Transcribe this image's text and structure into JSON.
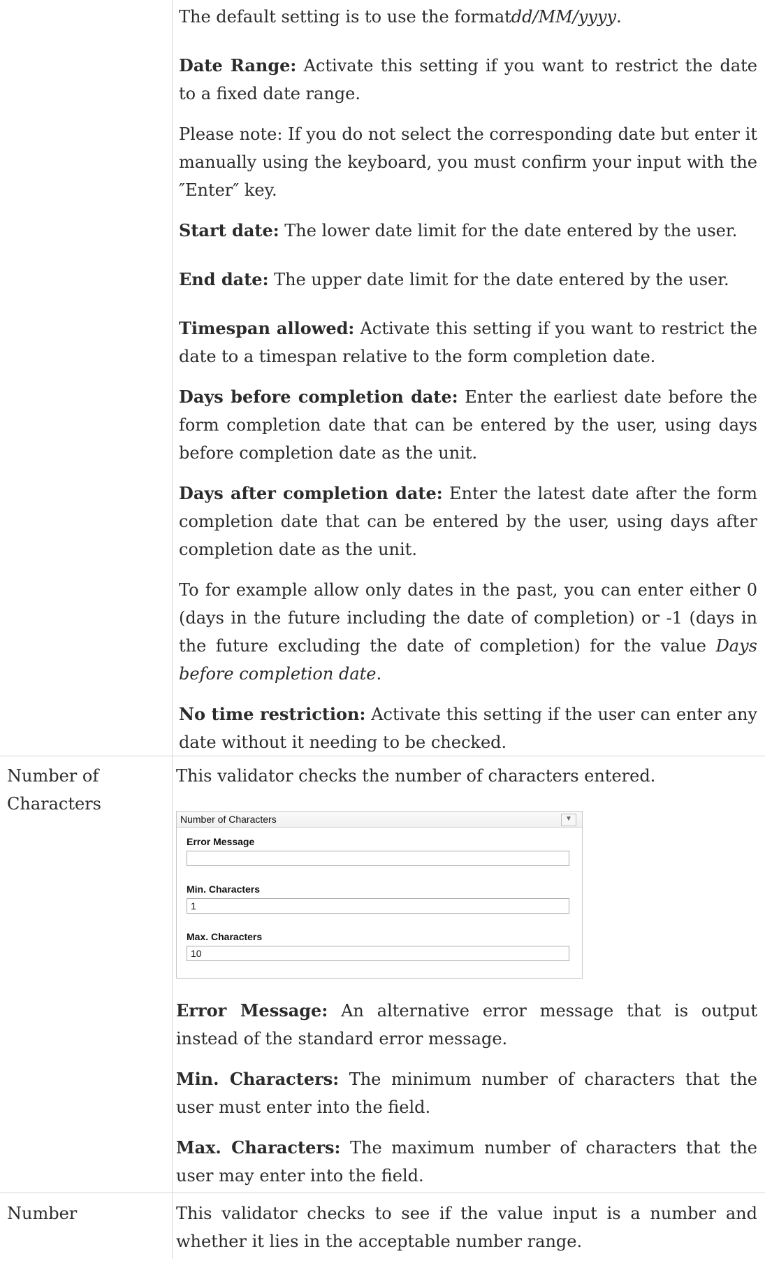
{
  "date_section": {
    "para1": "The default setting is to use the format",
    "format": "dd/MM/yyyy",
    "period": ".",
    "date_range_term": "Date Range:",
    "date_range_desc": "Activate this setting if you want to restrict the date to a fixed date range.",
    "note": "Please note: If you do not select the corresponding date but enter it manually using the keyboard, you must confirm your input with the ″Enter″ key.",
    "start_term": "Start date:",
    "start_desc": "The lower date limit for the date entered by the user.",
    "end_term": "End date:",
    "end_desc": "The upper date limit for the date entered by the user.",
    "timespan_term": "Timespan allowed:",
    "timespan_desc": "Activate this setting if you want to restrict the date to a timespan relative to the form completion date.",
    "days_before_term": "Days before completion date:",
    "days_before_desc": "Enter the earliest date before the form completion date that can be entered by the user, using days before completion date as the unit.",
    "days_after_term": "Days after completion date:",
    "days_after_desc": "Enter the latest date after the form completion date that can be entered by the user, using days after completion date as the unit.",
    "example_text": "To for example allow only dates in the past, you can enter either 0 (days in the future including the date of completion) or -1 (days in the future excluding the date of completion) for the value",
    "example_italic": "Days before completion date",
    "example_end": ".",
    "no_time_term": "No time restriction:",
    "no_time_desc": "Activate this setting if the user can enter any date without it needing to be checked."
  },
  "number_characters_section": {
    "left_label": "Number of Characters",
    "intro": "This validator checks the number of characters entered.",
    "panel": {
      "title": "Number of Characters",
      "dropdown_icon": "chevron-down-icon",
      "error_message_label": "Error Message",
      "error_message_value": "",
      "min_label": "Min. Characters",
      "min_value": "1",
      "max_label": "Max. Characters",
      "max_value": "10"
    },
    "error_term": "Error Message:",
    "error_desc": "An alternative error message that is output instead of the standard error message.",
    "min_term": "Min. Characters:",
    "min_desc": "The minimum number of characters that the user must enter into the field.",
    "max_term": "Max. Characters:",
    "max_desc": "The maximum number of characters that the user may enter into the field."
  },
  "number_section": {
    "left_label": "Number",
    "intro": "This validator checks to see if the value input is a number and whether it lies in the acceptable number range."
  }
}
